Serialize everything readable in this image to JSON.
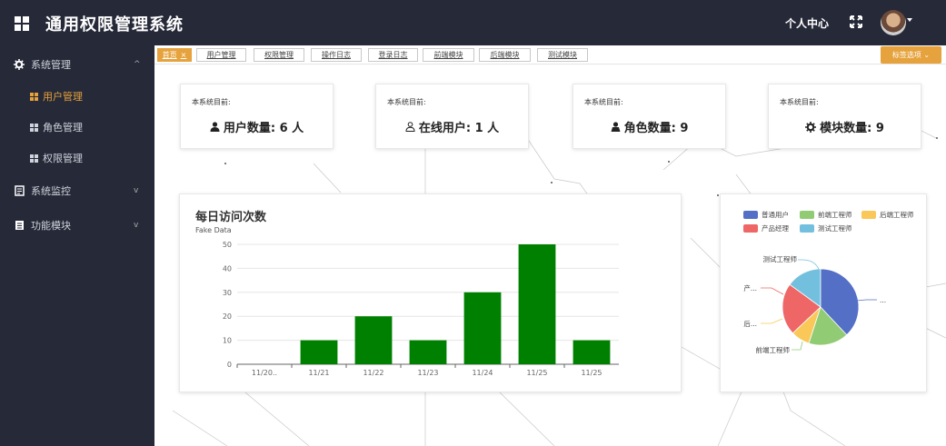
{
  "header": {
    "app_title": "通用权限管理系统",
    "profile_label": "个人中心",
    "icons": {
      "logo": "grid-icon",
      "fullscreen": "fullscreen-icon",
      "avatar": "avatar"
    }
  },
  "sidebar": {
    "items": [
      {
        "label": "系统管理",
        "icon": "gear-icon",
        "caret": "^"
      },
      {
        "label": "用户管理",
        "icon": "grid-icon",
        "active": true
      },
      {
        "label": "角色管理",
        "icon": "grid-icon"
      },
      {
        "label": "权限管理",
        "icon": "grid-icon"
      },
      {
        "label": "系统监控",
        "icon": "monitor-icon",
        "caret": "v"
      },
      {
        "label": "功能模块",
        "icon": "document-icon",
        "caret": "v"
      }
    ]
  },
  "tabs": {
    "items": [
      {
        "label": "首页",
        "close": "×",
        "active": true
      },
      {
        "label": "用户管理"
      },
      {
        "label": "权限管理"
      },
      {
        "label": "操作日志"
      },
      {
        "label": "登录日志"
      },
      {
        "label": "前端模块"
      },
      {
        "label": "后端模块"
      },
      {
        "label": "测试模块"
      }
    ],
    "options_label": "标签选项 ⌄"
  },
  "stats": [
    {
      "caption": "本系统目前:",
      "icon": "user-icon",
      "text": "用户数量: 6 人"
    },
    {
      "caption": "本系统目前:",
      "icon": "user-outline-icon",
      "text": "在线用户: 1 人"
    },
    {
      "caption": "本系统目前:",
      "icon": "user-tie-icon",
      "text": "角色数量: 9"
    },
    {
      "caption": "本系统目前:",
      "icon": "gear-icon",
      "text": "模块数量: 9"
    }
  ],
  "bar_panel": {
    "title": "每日访问次数",
    "subtitle": "Fake Data"
  },
  "pie_panel": {
    "labels": {
      "label_test": "测试工程师",
      "label_product": "产...",
      "label_backend": "后...",
      "label_frontend": "前端工程师",
      "label_normal": "..."
    }
  },
  "chart_data": [
    {
      "type": "bar",
      "title": "每日访问次数",
      "subtitle": "Fake Data",
      "categories": [
        "11/20..",
        "11/21",
        "11/22",
        "11/23",
        "11/24",
        "11/25",
        "11/25"
      ],
      "values": [
        0,
        10,
        20,
        10,
        30,
        50,
        10
      ],
      "ylim": [
        0,
        50
      ],
      "yticks": [
        0,
        10,
        20,
        30,
        40,
        50
      ],
      "color": "#008000",
      "grid": true
    },
    {
      "type": "pie",
      "legend": [
        "普通用户",
        "前端工程师",
        "后端工程师",
        "产品经理",
        "测试工程师"
      ],
      "values": [
        38,
        17,
        8,
        22,
        15
      ],
      "colors": [
        "#5470c6",
        "#91cc75",
        "#fac858",
        "#ee6666",
        "#73c0de"
      ],
      "legend_position": "top"
    }
  ]
}
